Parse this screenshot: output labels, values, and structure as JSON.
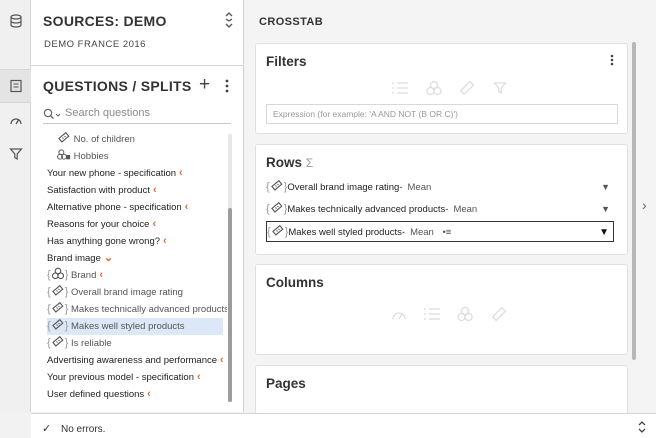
{
  "sources": {
    "title": "SOURCES: DEMO",
    "subtitle": "DEMO FRANCE 2016"
  },
  "questions": {
    "title": "QUESTIONS / SPLITS",
    "add_label": "+",
    "search_placeholder": "Search questions",
    "items": [
      {
        "label": "No. of children",
        "icon": "ruler-icon",
        "level": 1
      },
      {
        "label": "Hobbies",
        "icon": "group-icon",
        "level": 1
      },
      {
        "label": "Your new phone - specification",
        "chev": "‹",
        "level": 0
      },
      {
        "label": "Satisfaction with product",
        "chev": "‹",
        "level": 0
      },
      {
        "label": "Alternative phone - specification",
        "chev": "‹",
        "level": 0
      },
      {
        "label": "Reasons for your choice",
        "chev": "‹",
        "level": 0
      },
      {
        "label": "Has anything gone wrong?",
        "chev": "‹",
        "level": 0
      },
      {
        "label": "Brand image",
        "chev": "⌄",
        "level": 0
      },
      {
        "label": "Brand",
        "chev": "‹",
        "icon": "circles-icon",
        "level": 2
      },
      {
        "label": "Overall brand image rating",
        "icon": "ruler-icon",
        "level": 2
      },
      {
        "label": "Makes technically advanced products",
        "icon": "ruler-icon",
        "level": 2
      },
      {
        "label": "Makes well styled products",
        "icon": "ruler-icon",
        "level": 2,
        "selected": true
      },
      {
        "label": "Is reliable",
        "icon": "ruler-icon",
        "level": 2
      },
      {
        "label": "Advertising awareness and performance",
        "chev": "‹",
        "level": 0
      },
      {
        "label": "Your previous model - specification",
        "chev": "‹",
        "level": 0
      },
      {
        "label": "User defined questions",
        "chev": "‹",
        "level": 0
      }
    ]
  },
  "crosstab": {
    "title": "CROSSTAB",
    "filters": {
      "title": "Filters",
      "expression_placeholder": "Expression (for example: 'A AND NOT (B OR C)')"
    },
    "rows": {
      "title": "Rows",
      "sigma": "Σ",
      "items": [
        {
          "label": "Overall brand image rating",
          "stat": "Mean",
          "dash": "-"
        },
        {
          "label": "Makes technically advanced products",
          "stat": "Mean",
          "dash": "-"
        },
        {
          "label": "Makes well styled products",
          "stat": "Mean",
          "dash": "-",
          "selected": true,
          "extra": "•≡"
        }
      ]
    },
    "columns": {
      "title": "Columns"
    },
    "pages": {
      "title": "Pages"
    }
  },
  "status": {
    "message": "No errors."
  },
  "colors": {
    "accent": "#e06b2f",
    "selection": "#dce8f8"
  }
}
